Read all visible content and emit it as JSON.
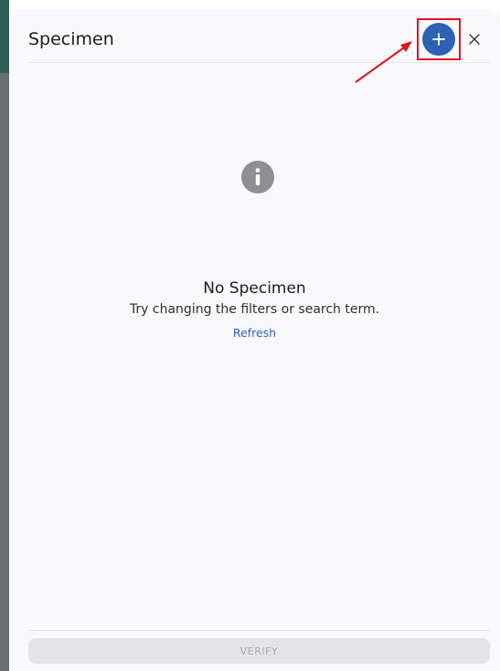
{
  "header": {
    "title": "Specimen",
    "add_icon": "plus-icon",
    "close_icon": "close-icon"
  },
  "empty_state": {
    "icon": "info-icon",
    "title": "No Specimen",
    "subtitle": "Try changing the filters or search term.",
    "refresh_label": "Refresh"
  },
  "footer": {
    "verify_label": "VERIFY"
  },
  "colors": {
    "accent": "#2d62b5",
    "highlight": "#e0141e",
    "icon_grey": "#8e8e93",
    "disabled_bg": "#e4e4e8",
    "disabled_text": "#a7a7ad"
  }
}
